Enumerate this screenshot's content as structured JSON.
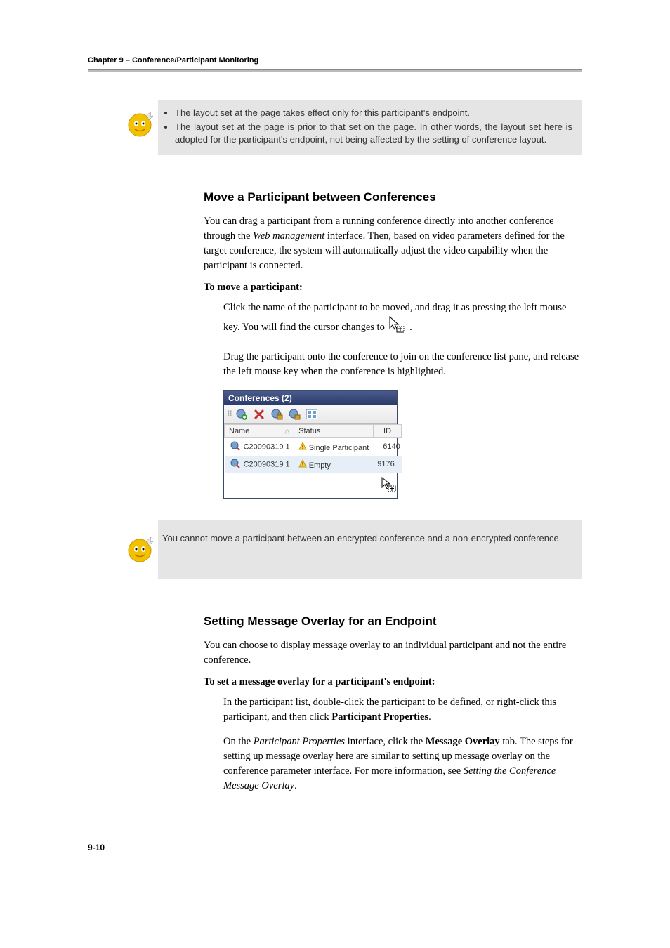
{
  "header": {
    "chapter": "Chapter 9 – Conference/Participant Monitoring"
  },
  "note1": {
    "bullet1_part1": "The  layout  set  at  the  ",
    "bullet1_part2": "  page  takes  effect  only  for  this participant's endpoint.",
    "bullet2_part1": "The  layout  set  at  the  ",
    "bullet2_part2": "  page  is  prior  to  that  set  on  the  ",
    "bullet2_part3": " page. In other words, the layout set here is adopted for the participant's endpoint, not being affected by the setting of conference layout."
  },
  "section1": {
    "title": "Move a Participant between Conferences",
    "para1_a": "You can drag a participant from a running conference directly into another conference through the ",
    "para1_italic": "Web management",
    "para1_b": " interface. Then, based on video parameters defined for the target conference, the system will automatically adjust the video capability when the participant is connected.",
    "lead": "To move a participant:",
    "step1_a": "Click the name of the participant to be moved, and drag it as pressing the left mouse key. You will find the cursor changes to ",
    "step1_b": ".",
    "step2": "Drag the participant onto the conference to join on the conference list pane, and release the left mouse key when the conference is highlighted."
  },
  "screenshot": {
    "title": "Conferences (2)",
    "col_name": "Name",
    "col_status": "Status",
    "col_id": "ID",
    "rows": [
      {
        "name": "C20090319 1",
        "status": "Single Participant",
        "id": "6140"
      },
      {
        "name": "C20090319 1",
        "status": "Empty",
        "id": "9176"
      }
    ]
  },
  "note2": {
    "text": "You  cannot  move  a  participant  between  an  encrypted  conference  and  a non-encrypted conference."
  },
  "section2": {
    "title": "Setting Message Overlay for an Endpoint",
    "para1": "You can choose to display message overlay to an individual participant and not the entire conference.",
    "lead": "To set a message overlay for a participant's endpoint:",
    "step1_a": "In the participant list, double-click the participant to be defined, or right-click this participant, and then click ",
    "step1_bold": "Participant Properties",
    "step1_b": ".",
    "step2_a": "On the ",
    "step2_italic1": "Participant Properties",
    "step2_b": " interface, click the ",
    "step2_bold": "Message Overlay",
    "step2_c": " tab. The steps for setting up message overlay here are similar to setting up message overlay on the conference parameter interface. For more information, see ",
    "step2_italic2": "Setting the Conference Message Overlay",
    "step2_d": "."
  },
  "footer": {
    "pagenum": "9-10"
  }
}
